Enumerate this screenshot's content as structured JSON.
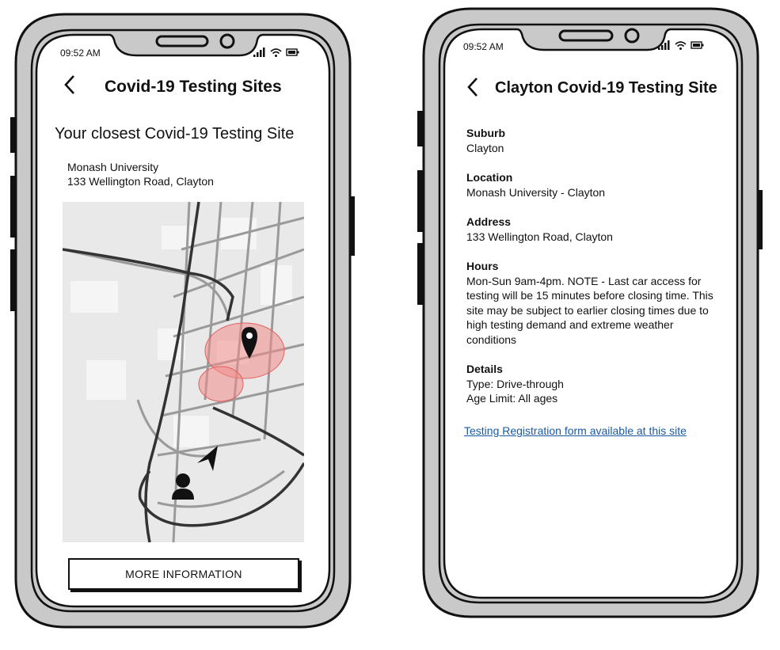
{
  "left_screen": {
    "status": {
      "time": "09:52 AM",
      "icons": [
        "signal-icon",
        "wifi-icon",
        "battery-icon"
      ]
    },
    "header": {
      "back_label": "<",
      "title": "Covid-19 Testing Sites"
    },
    "subtitle": "Your closest Covid-19 Testing Site",
    "site": {
      "name": "Monash University",
      "address": "133 Wellington Road, Clayton"
    },
    "map": {
      "icons": [
        "location-pin-icon",
        "user-icon",
        "navigation-arrow-icon"
      ],
      "highlight_color": "#f28b8b"
    },
    "button_label": "MORE INFORMATION"
  },
  "right_screen": {
    "status": {
      "time": "09:52 AM",
      "icons": [
        "signal-icon",
        "wifi-icon",
        "battery-icon"
      ]
    },
    "header": {
      "back_label": "<",
      "title": "Clayton Covid-19 Testing Site"
    },
    "fields": {
      "suburb": {
        "label": "Suburb",
        "value": "Clayton"
      },
      "location": {
        "label": "Location",
        "value": "Monash University - Clayton"
      },
      "address": {
        "label": "Address",
        "value": "133 Wellington Road, Clayton"
      },
      "hours": {
        "label": "Hours",
        "value": "Mon-Sun 9am-4pm. NOTE - Last car access for testing will be 15 minutes before closing time. This site may be subject to earlier closing times due to high testing demand and extreme weather conditions"
      },
      "details": {
        "label": "Details",
        "type": "Type: Drive-through",
        "age": "Age Limit: All ages"
      }
    },
    "link": "Testing Registration form available at this site",
    "link_color": "#1a5aa0"
  }
}
